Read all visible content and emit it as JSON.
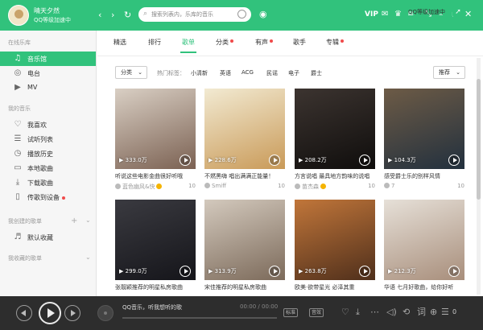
{
  "header": {
    "username": "晴天夕然",
    "vip_subtitle": "QQ等级加速中",
    "search_placeholder": "搜索列表内，乐库的音乐",
    "vip_label": "VIP"
  },
  "sidebar": {
    "section_online": "在线乐库",
    "online_items": [
      {
        "label": "音乐馆",
        "icon": "music-hall-icon",
        "active": true
      },
      {
        "label": "电台",
        "icon": "radio-icon",
        "active": false
      },
      {
        "label": "MV",
        "icon": "mv-icon",
        "active": false
      }
    ],
    "section_my": "我的音乐",
    "my_items": [
      {
        "label": "我喜欢",
        "icon": "heart-icon"
      },
      {
        "label": "试听列表",
        "icon": "list-icon"
      },
      {
        "label": "播放历史",
        "icon": "history-icon"
      },
      {
        "label": "本地歌曲",
        "icon": "local-icon"
      },
      {
        "label": "下载歌曲",
        "icon": "download-icon"
      },
      {
        "label": "传歌到设备",
        "icon": "device-icon"
      }
    ],
    "section_created": "我创建的歌单",
    "created_items": [
      {
        "label": "默认收藏",
        "icon": "playlist-icon"
      }
    ],
    "section_collected": "我收藏的歌单"
  },
  "tabs": [
    {
      "label": "精选",
      "dot": false
    },
    {
      "label": "排行",
      "dot": false
    },
    {
      "label": "歌单",
      "dot": false,
      "active": true
    },
    {
      "label": "分类",
      "dot": true
    },
    {
      "label": "有声",
      "dot": true
    },
    {
      "label": "歌手",
      "dot": false
    },
    {
      "label": "专辑",
      "dot": true
    }
  ],
  "speedup_label": "QQ等级加速中",
  "filters": {
    "category_label": "分类",
    "hot_label": "热门标签：",
    "tags": [
      "小清新",
      "英语",
      "ACG",
      "民谣",
      "电子",
      "爵士"
    ],
    "sort_label": "推荐"
  },
  "playlists": [
    {
      "plays": "333.0万",
      "title": "听说这些电影金曲很好听哦",
      "author": "蓝色幽风&快",
      "count": "10",
      "colors": [
        "#d9cfc4",
        "#7b6152"
      ]
    },
    {
      "plays": "228.6万",
      "title": "不燃黑嗨 唱出满满正能量！",
      "author": "Smiff",
      "count": "10",
      "colors": [
        "#f2ead2",
        "#c99a58"
      ]
    },
    {
      "plays": "208.2万",
      "title": "方言说唱 最具地方韵味的说唱",
      "author": "苗杰森",
      "count": "10",
      "colors": [
        "#3c3430",
        "#0f0d0c"
      ]
    },
    {
      "plays": "104.3万",
      "title": "感受爵士乐的别样风情",
      "author": "7",
      "count": "10",
      "colors": [
        "#6d5b46",
        "#22303e"
      ]
    },
    {
      "plays": "299.0万",
      "title": "张靓颖推荐的明星私房歌曲",
      "author": "",
      "count": "10",
      "colors": [
        "#3a3a40",
        "#15151a"
      ]
    },
    {
      "plays": "313.9万",
      "title": "宋佳推荐的明星私房歌曲",
      "author": "",
      "count": "10",
      "colors": [
        "#d3c9bd",
        "#7c6a5a"
      ]
    },
    {
      "plays": "263.8万",
      "title": "欧美·欲带星光 必泽其重",
      "author": "",
      "count": "10",
      "colors": [
        "#c1763a",
        "#4f2f1b"
      ]
    },
    {
      "plays": "212.3万",
      "title": "华语 七月好歌曲，给你好听",
      "author": "",
      "count": "10",
      "colors": [
        "#e6e0d8",
        "#a88e7b"
      ]
    }
  ],
  "player": {
    "now_playing": "QQ音乐，听我想听的歌",
    "time_current": "00:00",
    "time_total": "00:00",
    "quality_label": "标准",
    "sound_label": "音效",
    "queue_count": "0",
    "progress": 0
  },
  "colors": {
    "accent": "#31c27c",
    "player_bg": "#2d2d2d"
  }
}
